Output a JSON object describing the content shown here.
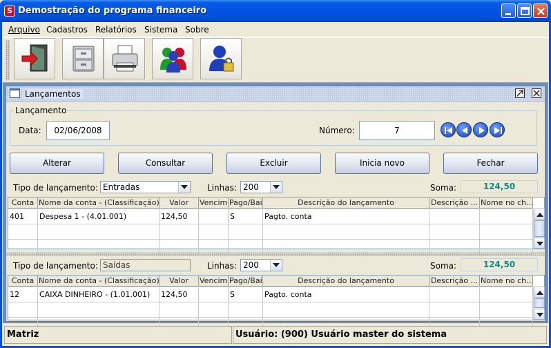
{
  "window": {
    "title": "Demostração do programa financeiro",
    "icon_letter": "S"
  },
  "menu": [
    {
      "label": "Arquivo"
    },
    {
      "label": "Cadastros"
    },
    {
      "label": "Relatórios"
    },
    {
      "label": "Sistema"
    },
    {
      "label": "Sobre"
    }
  ],
  "toolbar": [
    {
      "icon": "exit-door-icon"
    },
    {
      "icon": "filing-cabinet-icon"
    },
    {
      "icon": "printer-icon"
    },
    {
      "icon": "users-icon"
    },
    {
      "icon": "user-lock-icon"
    }
  ],
  "frame": {
    "title": "Lançamentos"
  },
  "lancamento": {
    "group_title": "Lançamento",
    "data_label": "Data:",
    "data_value": "02/06/2008",
    "numero_label": "Número:",
    "numero_value": "7"
  },
  "actions": {
    "alterar": "Alterar",
    "consultar": "Consultar",
    "excluir": "Excluir",
    "inicia_novo": "Inicia novo",
    "fechar": "Fechar"
  },
  "entradas": {
    "tipo_label": "Tipo de lançamento:",
    "tipo_value": "Entradas",
    "linhas_label": "Linhas:",
    "linhas_value": "200",
    "soma_label": "Soma:",
    "soma_value": "124,50",
    "columns": [
      "Conta",
      "Nome da conta - (Classificação)",
      "Valor",
      "Vencimento",
      "Pago/Baixado",
      "Descrição do lançamento",
      "Descrição ...",
      "Nome no ch..."
    ],
    "rows": [
      [
        "401",
        "Despesa 1 - (4.01.001)",
        "124,50",
        "",
        "S",
        "Pagto. conta",
        "",
        ""
      ]
    ]
  },
  "saidas": {
    "tipo_label": "Tipo de lançamento:",
    "tipo_value": "Saídas",
    "linhas_label": "Linhas:",
    "linhas_value": "200",
    "soma_label": "Soma:",
    "soma_value": "124,50",
    "columns": [
      "Conta",
      "Nome da conta - (Classificação)",
      "Valor",
      "Vencimento",
      "Pago/Baixado",
      "Descrição do lançamento",
      "Descrição ...",
      "Nome no ch..."
    ],
    "rows": [
      [
        "12",
        "CAIXA DINHEIRO - (1.01.001)",
        "124,50",
        "",
        "S",
        "Pagto. conta",
        "",
        ""
      ]
    ]
  },
  "status": {
    "left": "Matriz",
    "right": "Usuário: (900) Usuário master do sistema"
  }
}
